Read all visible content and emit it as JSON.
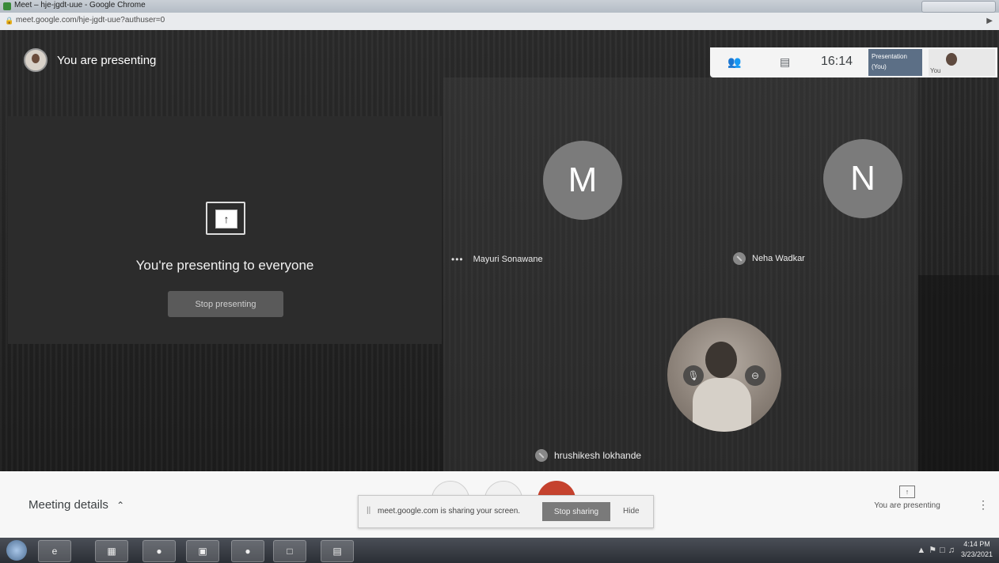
{
  "window": {
    "title": "Meet – hje-jgdt-uue - Google Chrome",
    "url": "meet.google.com/hje-jgdt-uue?authuser=0"
  },
  "header": {
    "presenting_title": "You are presenting"
  },
  "presenter_pane": {
    "message": "You're presenting to everyone",
    "stop_button": "Stop presenting"
  },
  "participants": [
    {
      "initial": "M",
      "name": "Mayuri Sonawane"
    },
    {
      "initial": "N",
      "name": "Neha Wadkar"
    }
  ],
  "self_view": {
    "name": "hrushikesh lokhande"
  },
  "topbar": {
    "time": "16:14",
    "presentation_label": "Presentation",
    "presentation_sub": "(You)",
    "you_label": "You"
  },
  "bottombar": {
    "meeting_details": "Meeting details",
    "you_are_presenting": "You are presenting"
  },
  "sharebar": {
    "message": "meet.google.com is sharing your screen.",
    "stop_sharing": "Stop sharing",
    "hide": "Hide"
  },
  "taskbar": {
    "time": "4:14 PM",
    "date": "3/23/2021"
  },
  "colors": {
    "stage_bg": "#202020",
    "end_call": "#c5422e",
    "avatar_grey": "#7b7b7b"
  }
}
